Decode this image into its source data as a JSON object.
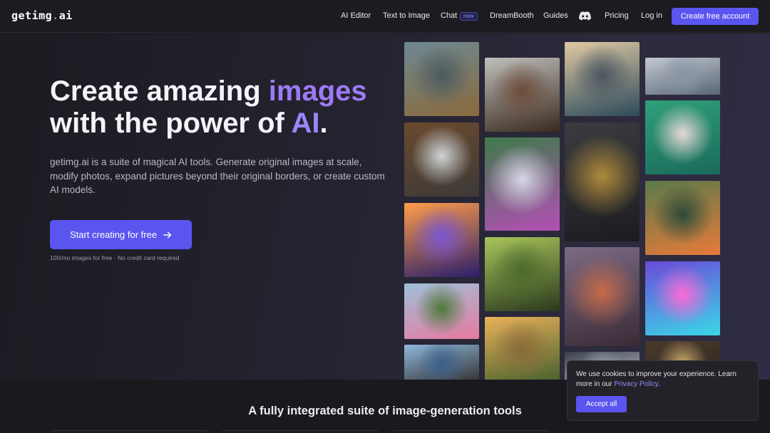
{
  "nav": {
    "logo_main": "getimg",
    "logo_dot": ".",
    "logo_tld": "ai",
    "links": [
      "AI Editor",
      "Text to Image",
      "Chat",
      "DreamBooth",
      "Guides",
      "Pricing",
      "Log in"
    ],
    "chat_badge": "new",
    "discord_icon": "discord-icon",
    "cta": "Create free account"
  },
  "hero": {
    "headline_l1_a": "Create amazing ",
    "headline_l1_b": "images",
    "headline_l2_a": "with the power of ",
    "headline_l2_b": "AI",
    "headline_l2_c": ".",
    "description": "getimg.ai is a suite of magical AI tools. Generate original images at scale, modify photos, expand pictures beyond their original borders, or create custom AI models.",
    "cta": "Start creating for free",
    "cta_icon": "arrow-right-icon",
    "note": "100/mo images for free · No credit card required"
  },
  "gallery": {
    "images": [
      {
        "name": "portrait-man-image",
        "colors": [
          "#6d8893",
          "#4c5a5f",
          "#8a6a3c"
        ]
      },
      {
        "name": "bedroom-cabin-image",
        "colors": [
          "#6a4a2e",
          "#cfd4d8",
          "#3d3a37"
        ]
      },
      {
        "name": "cosmic-cat-image",
        "colors": [
          "#ff9d4a",
          "#7a56d4",
          "#2b1e6a"
        ]
      },
      {
        "name": "roses-garden-image",
        "colors": [
          "#9fc0d9",
          "#4d7a3a",
          "#e77aa0"
        ]
      },
      {
        "name": "rider-horse-image",
        "colors": [
          "#8fb7dc",
          "#3b5f89",
          "#2a2622"
        ]
      },
      {
        "name": "curly-man-image",
        "colors": [
          "#bfbfbb",
          "#6d4c3a",
          "#3a2a20"
        ]
      },
      {
        "name": "flower-goddess-image",
        "colors": [
          "#3f7a4a",
          "#d8d6e8",
          "#b34fb5"
        ]
      },
      {
        "name": "meadow-tree-image",
        "colors": [
          "#a9c45a",
          "#4c6a2c",
          "#2a3a1e"
        ]
      },
      {
        "name": "pyramid-image",
        "colors": [
          "#e9b25a",
          "#8a6a3a",
          "#3a5a2a"
        ]
      },
      {
        "name": "stormy-sea-image",
        "colors": [
          "#e0c9a4",
          "#4a5560",
          "#2c4a5a"
        ]
      },
      {
        "name": "golden-skull-image",
        "colors": [
          "#3a3c40",
          "#b08a3c",
          "#1c1c20"
        ]
      },
      {
        "name": "mushroom-forest-image",
        "colors": [
          "#7a6a84",
          "#c76a4a",
          "#3a2c36"
        ]
      },
      {
        "name": "storm-sky-image",
        "colors": [
          "#3a3f4c",
          "#9aa2b0",
          "#d8dde6"
        ]
      },
      {
        "name": "clouds-image",
        "colors": [
          "#c3c9d1",
          "#8a96a6",
          "#5a6676"
        ]
      },
      {
        "name": "anime-girl-image",
        "colors": [
          "#2fa07a",
          "#e8d8d8",
          "#1a6a5a"
        ]
      },
      {
        "name": "koi-pond-image",
        "colors": [
          "#5a7a4a",
          "#2c4a3a",
          "#e87a3a"
        ]
      },
      {
        "name": "hamster-neon-image",
        "colors": [
          "#6a4ad8",
          "#ff6ad8",
          "#3ad8e8"
        ]
      },
      {
        "name": "ornate-gold-image",
        "colors": [
          "#4a3a2a",
          "#c8a86a",
          "#2a2420"
        ]
      }
    ]
  },
  "section": {
    "title": "A fully integrated suite of image-generation tools"
  },
  "cookie": {
    "text_a": "We use cookies to improve your experience. Learn more in our ",
    "link": "Privacy Policy",
    "text_b": ".",
    "accept": "Accept all"
  }
}
